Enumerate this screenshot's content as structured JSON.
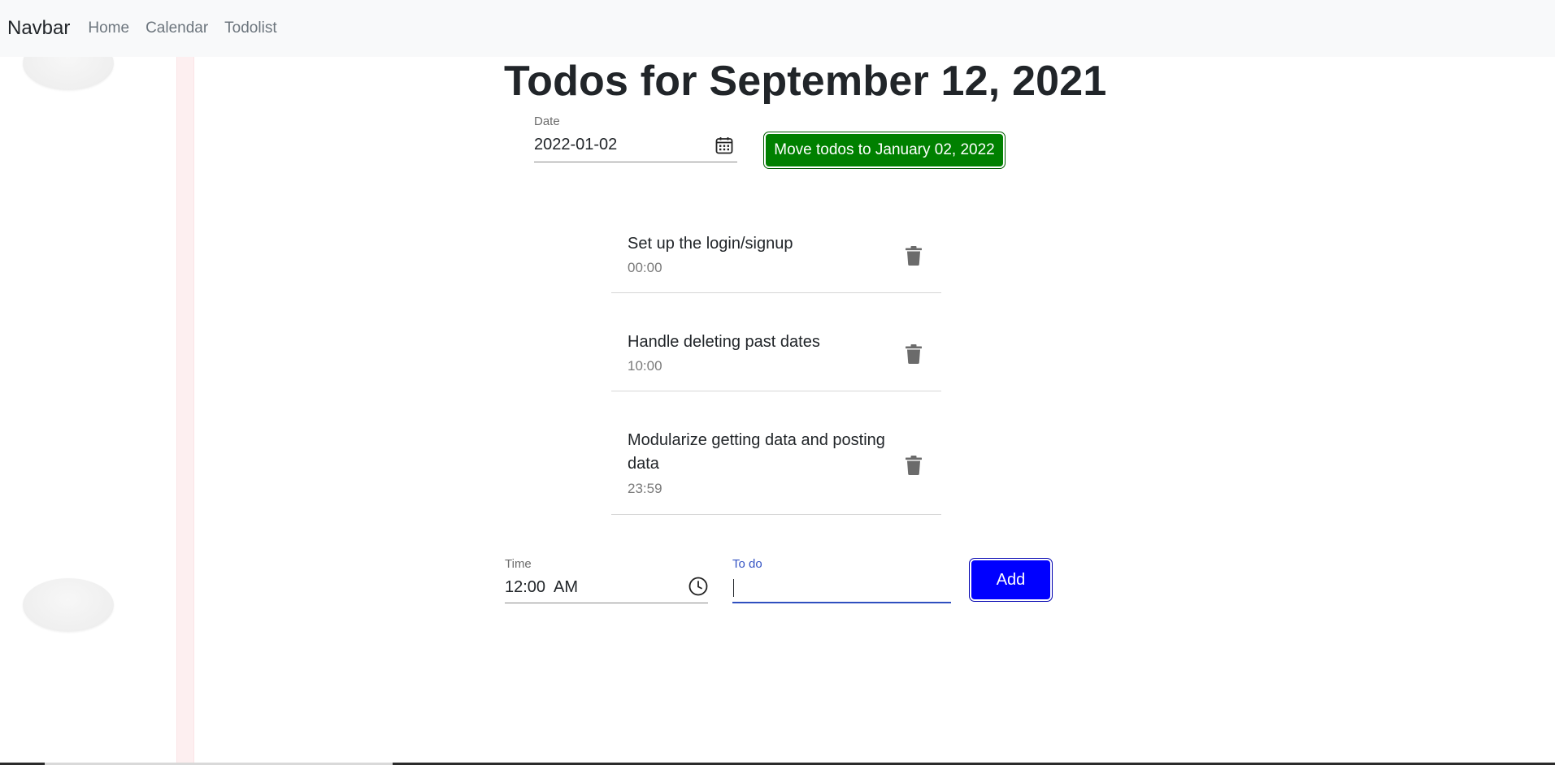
{
  "navbar": {
    "brand": "Navbar",
    "links": [
      "Home",
      "Calendar",
      "Todolist"
    ]
  },
  "page": {
    "title": "Todos for September 12, 2021"
  },
  "date_picker": {
    "label": "Date",
    "value": "2022-01-02",
    "icon": "calendar-icon"
  },
  "move_button": {
    "label": "Move todos to January 02, 2022",
    "color": "#008000"
  },
  "todos": [
    {
      "text": "Set up the login/signup",
      "time": "00:00"
    },
    {
      "text": "Handle deleting past dates",
      "time": "10:00"
    },
    {
      "text": "Modularize getting data and posting data",
      "time": "23:59"
    }
  ],
  "time_picker": {
    "label": "Time",
    "value": "12:00  AM",
    "icon": "clock-icon"
  },
  "todo_input": {
    "label": "To do",
    "value": ""
  },
  "add_button": {
    "label": "Add",
    "color": "#0000ff"
  }
}
